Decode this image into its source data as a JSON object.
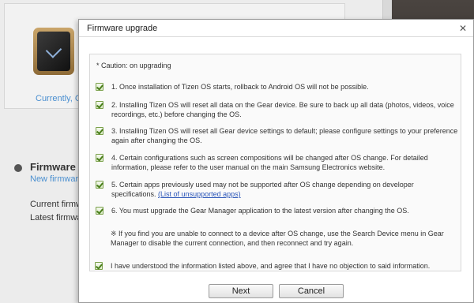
{
  "background": {
    "device_status": "Currently, GAL",
    "firmware": {
      "title": "Firmware in",
      "new_link": "New firmware",
      "current_label": "Current firmw",
      "latest_label": "Latest firmwa"
    }
  },
  "dialog": {
    "title": "Firmware upgrade",
    "close_icon": "close-icon",
    "caution": "* Caution: on upgrading",
    "items": [
      {
        "checked": true,
        "text": "1. Once installation of Tizen OS starts, rollback to Android OS will not be possible."
      },
      {
        "checked": true,
        "text": "2. Installing Tizen OS will reset all data on the Gear device. Be sure to back up all data (photos, videos, voice recordings, etc.) before changing the OS."
      },
      {
        "checked": true,
        "text": "3. Installing Tizen OS will reset all Gear device settings to default; please configure settings to your preference again after changing the OS."
      },
      {
        "checked": true,
        "text": "4. Certain configurations such as screen compositions will be changed after OS change. For detailed information, please refer to the user manual on the main Samsung Electronics website."
      },
      {
        "checked": true,
        "text": "5. Certain apps previously used may not be supported after OS change depending on developer specifications.",
        "link": "(List of unsupported apps)"
      },
      {
        "checked": true,
        "text": "6. You must upgrade the Gear Manager application to the latest version after changing the OS."
      }
    ],
    "note": "※ If you find you are unable to connect to a device after OS change, use the Search Device menu in Gear Manager to disable the current connection, and then reconnect and try again.",
    "agree": {
      "checked": true,
      "text": "I have understood the information listed above, and agree that I have no objection to said information."
    },
    "buttons": {
      "next": "Next",
      "cancel": "Cancel"
    }
  }
}
